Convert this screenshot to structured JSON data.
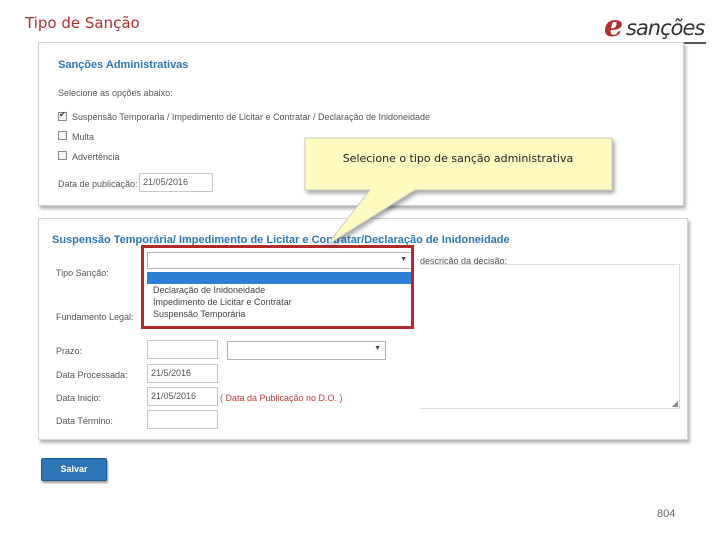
{
  "slide": {
    "title": "Tipo de Sanção",
    "page_number": "804"
  },
  "logo": {
    "initial": "e",
    "word": "sanções"
  },
  "panel_admin": {
    "title": "Sanções Administrativas",
    "select_label": "Selecione as opções abaixo:",
    "options": [
      {
        "label": "Suspensão Temporaria / Impedimento de Licitar e Contratar / Declaração de Inidoneidade",
        "checked": true
      },
      {
        "label": "Multa",
        "checked": false
      },
      {
        "label": "Advertência",
        "checked": false
      }
    ],
    "pub_date_label": "Data de publicação:",
    "pub_date_value": "21/05/2016"
  },
  "callout": {
    "text": "Selecione o tipo de sanção administrativa"
  },
  "panel_suspension": {
    "title": "Suspensão Temporária/ Impedimento de Licitar e Contratar/Declaração de Inidoneidade",
    "tipo_label": "Tipo Sanção:",
    "fundamento_label": "Fundamento Legal:",
    "descricao_label": "descrição da decisão:",
    "dropdown_options": [
      "",
      "Declaração de Inidoneidade",
      "Impedimento de Licitar e Contratar",
      "Suspensão Temporária"
    ],
    "prazo_label": "Prazo:",
    "data_processada_label": "Data Processada:",
    "data_processada_value": "21/5/2016",
    "data_inicio_label": "Data Inicio:",
    "data_inicio_value": "21/05/2016",
    "data_inicio_note": "( Data da Publicação no D.O. )",
    "data_termino_label": "Data Término:"
  },
  "actions": {
    "save_label": "Salvar"
  },
  "colors": {
    "accent_blue": "#2c78b4",
    "title_red": "#b22d2d",
    "highlight_blue": "#2e7fd8",
    "frame_red": "#b02a2a",
    "callout_yellow": "#fdfbc0"
  }
}
